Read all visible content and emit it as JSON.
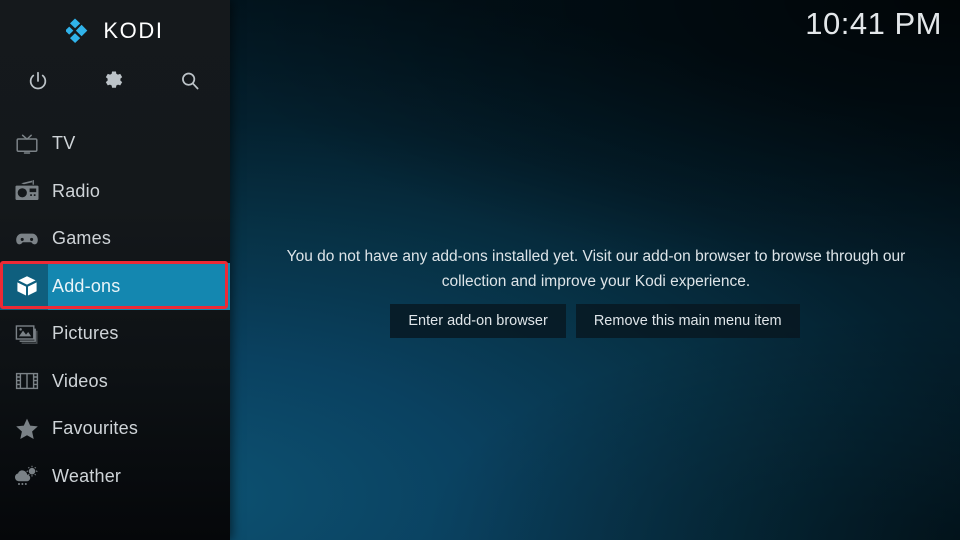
{
  "app": {
    "brand_name": "KODI",
    "brand_logo_icon": "kodi-logo-icon"
  },
  "clock": {
    "time": "10:41 PM"
  },
  "toolbar": {
    "buttons": [
      {
        "name": "power-button",
        "icon": "power-icon"
      },
      {
        "name": "settings-button",
        "icon": "gear-icon"
      },
      {
        "name": "search-button",
        "icon": "search-icon"
      }
    ]
  },
  "sidebar": {
    "items": [
      {
        "label": "TV",
        "icon": "tv-icon",
        "selected": false
      },
      {
        "label": "Radio",
        "icon": "radio-icon",
        "selected": false
      },
      {
        "label": "Games",
        "icon": "gamepad-icon",
        "selected": false
      },
      {
        "label": "Add-ons",
        "icon": "open-box-icon",
        "selected": true
      },
      {
        "label": "Pictures",
        "icon": "picture-icon",
        "selected": false
      },
      {
        "label": "Videos",
        "icon": "filmstrip-icon",
        "selected": false
      },
      {
        "label": "Favourites",
        "icon": "star-icon",
        "selected": false
      },
      {
        "label": "Weather",
        "icon": "cloud-rain-icon",
        "selected": false
      }
    ]
  },
  "main": {
    "empty_message": "You do not have any add-ons installed yet. Visit our add-on browser to browse through our collection and improve your Kodi experience.",
    "buttons": [
      {
        "label": "Enter add-on browser"
      },
      {
        "label": "Remove this main menu item"
      }
    ]
  },
  "colors": {
    "accent": "#1487b0",
    "accent_dark": "#0f5f7e",
    "annotation": "#ee2a35",
    "brand_blue": "#30b3ea",
    "sidebar_bg": "#14181b"
  }
}
